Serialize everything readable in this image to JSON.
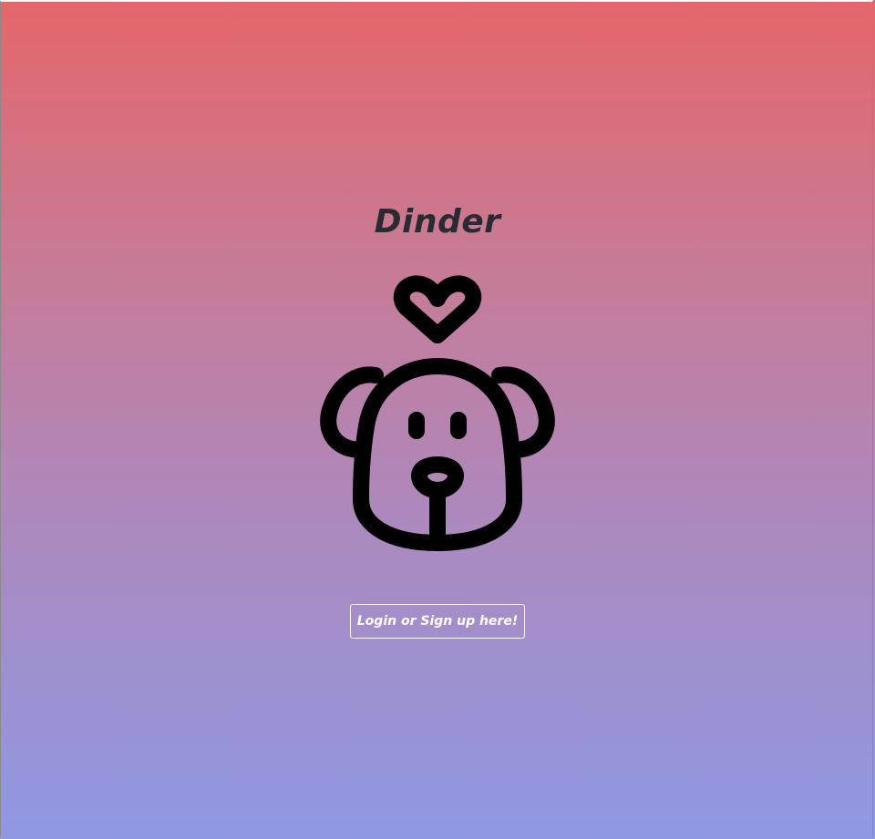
{
  "app": {
    "title": "Dinder"
  },
  "hero": {
    "logo_icon": "dog-with-heart-icon"
  },
  "actions": {
    "login_label": "Login or Sign up here!"
  },
  "colors": {
    "gradient_top": "#e4666a",
    "gradient_bottom": "#8f98e3",
    "title_text": "#2a2a33",
    "button_text": "#ffffff",
    "button_border": "#ffffff"
  }
}
